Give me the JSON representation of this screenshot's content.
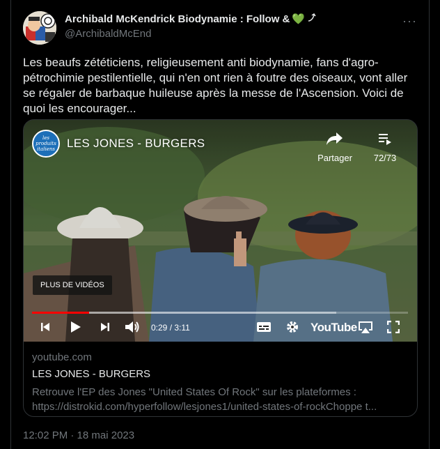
{
  "author": {
    "display_name": "Archibald McKendrick Biodynamie : Follow &",
    "name_emoji": "💚",
    "handle": "@ArchibaldMcEnd"
  },
  "menu": {
    "more_label": "···"
  },
  "tweet": {
    "text": "Les beaufs zététiciens, religieusement anti biodynamie, fans d'agro-pétrochimie pestilentielle, qui n'en ont rien à foutre des oiseaux, vont aller se régaler de barbaque huileuse après la messe de l'Ascension. Voici de quoi les encourager...",
    "timestamp": "12:02 PM · 18 mai 2023"
  },
  "player": {
    "channel_logo_text": "les produits italiens",
    "title": "LES JONES - BURGERS",
    "share_label": "Partager",
    "queue_label": "72/73",
    "more_videos_label": "PLUS DE VIDÉOS",
    "time": "0:29 / 3:11",
    "progress": 0.152,
    "buffered": 0.81,
    "youtube_label": "YouTube",
    "progress_color": "#ff0000"
  },
  "card": {
    "domain": "youtube.com",
    "title": "LES JONES - BURGERS",
    "description_line1": "Retrouve l'EP des Jones \"United States Of Rock\" sur les plateformes :",
    "description_line2": "https://distrokid.com/hyperfollow/lesjones1/united-states-of-rockChoppe t..."
  }
}
